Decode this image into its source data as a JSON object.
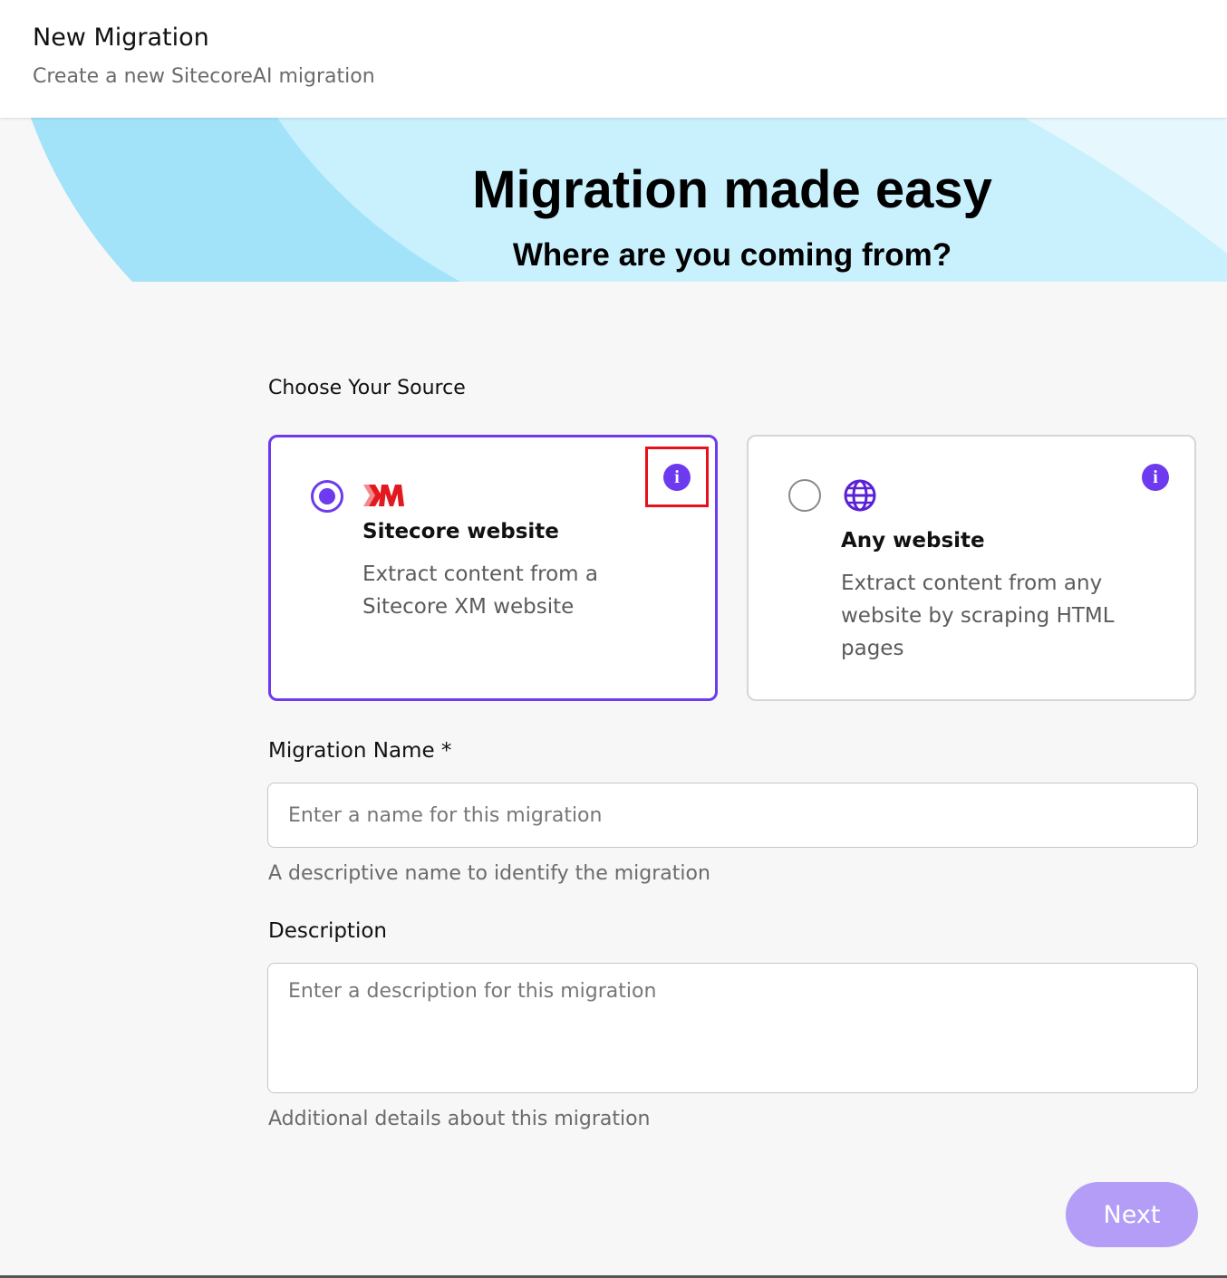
{
  "header": {
    "title": "New Migration",
    "subtitle": "Create a new SitecoreAI migration"
  },
  "banner": {
    "title": "Migration made easy",
    "subtitle": "Where are you coming from?"
  },
  "source": {
    "label": "Choose Your Source",
    "options": [
      {
        "title": "Sitecore website",
        "description": "Extract content from a Sitecore XM website",
        "logo": "XM",
        "icon": "sitecore-xm-logo",
        "selected": true
      },
      {
        "title": "Any website",
        "description": "Extract content from any website by scraping HTML pages",
        "icon": "globe-icon",
        "selected": false
      }
    ],
    "info_icon": "info-icon"
  },
  "form": {
    "name_label": "Migration Name *",
    "name_placeholder": "Enter a name for this migration",
    "name_value": "",
    "name_helper": "A descriptive name to identify the migration",
    "description_label": "Description",
    "description_placeholder": "Enter a description for this migration",
    "description_value": "",
    "description_helper": "Additional details about this migration"
  },
  "actions": {
    "next_label": "Next"
  },
  "colors": {
    "accent": "#6d3af0",
    "accent_disabled": "#b39df7",
    "highlight": "#e8101a",
    "xm_red": "#e3191f"
  }
}
